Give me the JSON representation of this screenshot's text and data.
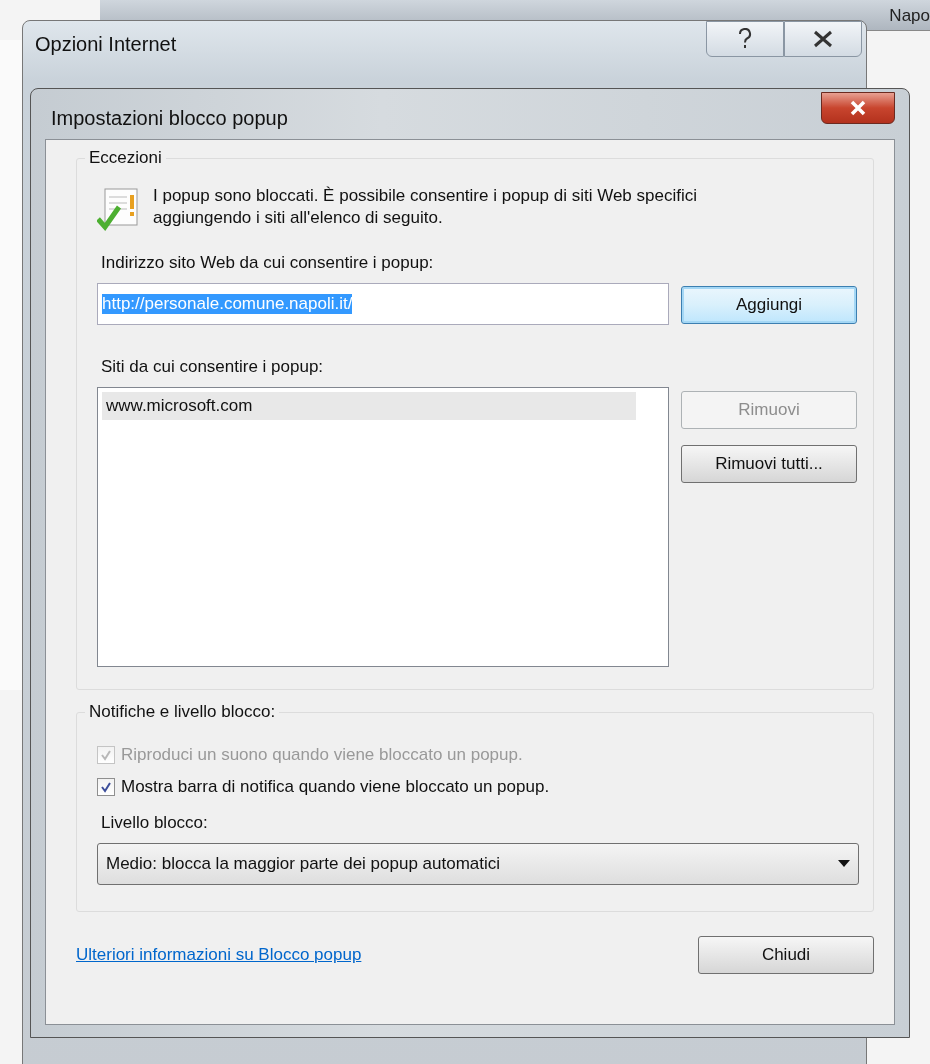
{
  "background_window": {
    "title_fragment": "Napo"
  },
  "parent_window": {
    "title": "Opzioni Internet"
  },
  "dialog": {
    "title": "Impostazioni blocco popup",
    "exceptions": {
      "title": "Eccezioni",
      "info": "I popup sono bloccati. È possibile consentire i popup di siti Web specifici aggiungendo i siti all'elenco di seguito.",
      "address_label": "Indirizzo sito Web da cui consentire i popup:",
      "address_field": {
        "value": "http://personale.comune.napoli.it/",
        "text_selected": true
      },
      "add_button": {
        "label": "Aggiungi",
        "disabled": false
      },
      "sites_label": "Siti da cui consentire i popup:",
      "sites": [
        {
          "label": "www.microsoft.com",
          "selected": true
        }
      ],
      "remove_button": {
        "label": "Rimuovi",
        "disabled": true
      },
      "remove_all_button": {
        "label": "Rimuovi tutti...",
        "disabled": false
      }
    },
    "notifications": {
      "title": "Notifiche e livello blocco:",
      "checkboxes": [
        {
          "label": "Riproduci un suono quando viene bloccato un popup.",
          "checked": true,
          "disabled": true
        },
        {
          "label": "Mostra barra di notifica quando viene bloccato un popup.",
          "checked": true,
          "disabled": false
        }
      ],
      "level_label": "Livello blocco:",
      "level_select": {
        "value": "Medio: blocca la maggior parte dei popup automatici"
      }
    },
    "link": "Ulteriori informazioni su Blocco popup",
    "close_button": {
      "label": "Chiudi",
      "disabled": false
    }
  }
}
